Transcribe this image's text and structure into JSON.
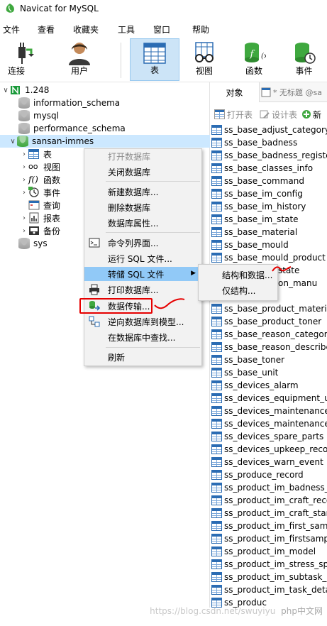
{
  "window": {
    "title": "Navicat for MySQL"
  },
  "menu": [
    "文件",
    "查看",
    "收藏夹",
    "工具",
    "窗口",
    "帮助"
  ],
  "toolbar": {
    "connect": "连接",
    "user": "用户",
    "table": "表",
    "view": "视图",
    "function": "函数",
    "event": "事件"
  },
  "tree": {
    "connection": "1.248",
    "databases": [
      "information_schema",
      "mysql",
      "performance_schema",
      "sansan-immes",
      "sys"
    ],
    "children": [
      "表",
      "视图",
      "函数",
      "事件",
      "查询",
      "报表",
      "备份"
    ]
  },
  "tabs": {
    "objects": "对象",
    "untitled": "* 无标题 @sa"
  },
  "obj_toolbar": {
    "open": "打开表",
    "design": "设计表",
    "new": "新"
  },
  "tables": [
    "ss_base_adjust_category",
    "ss_base_badness",
    "ss_base_badness_registe",
    "ss_base_classes_info",
    "ss_base_command",
    "ss_base_im_config",
    "ss_base_im_history",
    "ss_base_im_state",
    "ss_base_material",
    "ss_base_mould",
    "ss_base_mould_product",
    "state",
    "on_manu",
    "ss_base_product_materia",
    "ss_base_product_toner",
    "ss_base_reason_category",
    "ss_base_reason_describe",
    "ss_base_toner",
    "ss_base_unit",
    "ss_devices_alarm",
    "ss_devices_equipment_up",
    "ss_devices_maintenance_",
    "ss_devices_maintenance_",
    "ss_devices_spare_parts",
    "ss_devices_upkeep_recor",
    "ss_devices_warn_event",
    "ss_produce_record",
    "ss_product_im_badness_s",
    "ss_product_im_craft_reco",
    "ss_product_im_craft_stanc",
    "ss_product_im_first_samp",
    "ss_product_im_firstsample",
    "ss_product_im_model",
    "ss_product_im_stress_spe",
    "ss_product_im_subtask_sl",
    "ss_product_im_task_detai",
    "ss_produc"
  ],
  "context_menu": {
    "open_db": "打开数据库",
    "close_db": "关闭数据库",
    "new_db": "新建数据库...",
    "delete_db": "删除数据库",
    "db_props": "数据库属性...",
    "console": "命令列界面...",
    "run_sql": "运行 SQL 文件...",
    "dump_sql": "转储 SQL 文件",
    "print_db": "打印数据库...",
    "transfer": "数据传输...",
    "reverse": "逆向数据库到模型...",
    "find": "在数据库中查找...",
    "refresh": "刷新"
  },
  "submenu": {
    "structure_data": "结构和数据...",
    "structure_only": "仅结构..."
  },
  "watermark": "https://blog.csdn.net/swuyiyu",
  "watermark2": "php中文网",
  "colors": {
    "highlight": "#91c9f7",
    "selected": "#cce8ff",
    "annotation": "#e60000",
    "navicat_green": "#3fa83f"
  }
}
